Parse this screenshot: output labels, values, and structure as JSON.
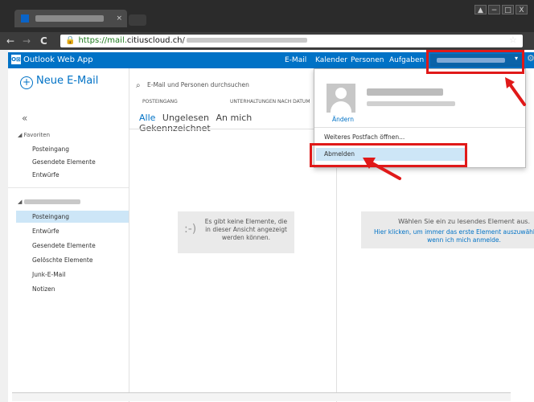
{
  "browser": {
    "url_prefix": "https://mail.",
    "url_domain": "citiuscloud.ch",
    "url_rest": "/",
    "tab_close": "×",
    "back": "←",
    "forward": "→",
    "reload": "C",
    "lock": "🔒",
    "star": "☆",
    "win_min": "−",
    "win_max": "□",
    "win_close": "X",
    "win_user": "▲"
  },
  "owa": {
    "logo_text": "Outlook Web App",
    "logo_badge": "O⊠",
    "nav": [
      "E-Mail",
      "Kalender",
      "Personen",
      "Aufgaben"
    ],
    "user_caret": "▾",
    "gear": "⚙"
  },
  "left": {
    "new_mail": "Neue E-Mail",
    "plus": "+",
    "collapse": "«",
    "favorites_head": "◢ Favoriten",
    "favorites": [
      "Posteingang",
      "Gesendete Elemente",
      "Entwürfe"
    ],
    "mailbox_arrow": "◢",
    "folders": [
      "Posteingang",
      "Entwürfe",
      "Gesendete Elemente",
      "Gelöschte Elemente",
      "Junk-E-Mail",
      "Notizen"
    ],
    "selected_folder": "Posteingang"
  },
  "middle": {
    "search_placeholder": "E-Mail und Personen durchsuchen",
    "search_icon": "⌕",
    "col_inbox": "POSTEINGANG",
    "col_conversations": "UNTERHALTUNGEN NACH DATUM",
    "filters": [
      "Alle",
      "Ungelesen",
      "An mich",
      "Gekennzeichnet"
    ],
    "empty_face": ":-)",
    "empty_text": "Es gibt keine Elemente, die in dieser Ansicht angezeigt werden können."
  },
  "reading": {
    "line1": "Wählen Sie ein zu lesendes Element aus.",
    "line2a": "Hier klicken, um immer das erste Element auszuwähl",
    "line2b": "wenn ich mich anmelde."
  },
  "dropdown": {
    "change": "Ändern",
    "other_mailbox": "Weiteres Postfach öffnen...",
    "logout": "Abmelden"
  },
  "colors": {
    "owa_blue": "#0072c6",
    "highlight_red": "#e01919",
    "selection_blue": "#cde6f7"
  }
}
